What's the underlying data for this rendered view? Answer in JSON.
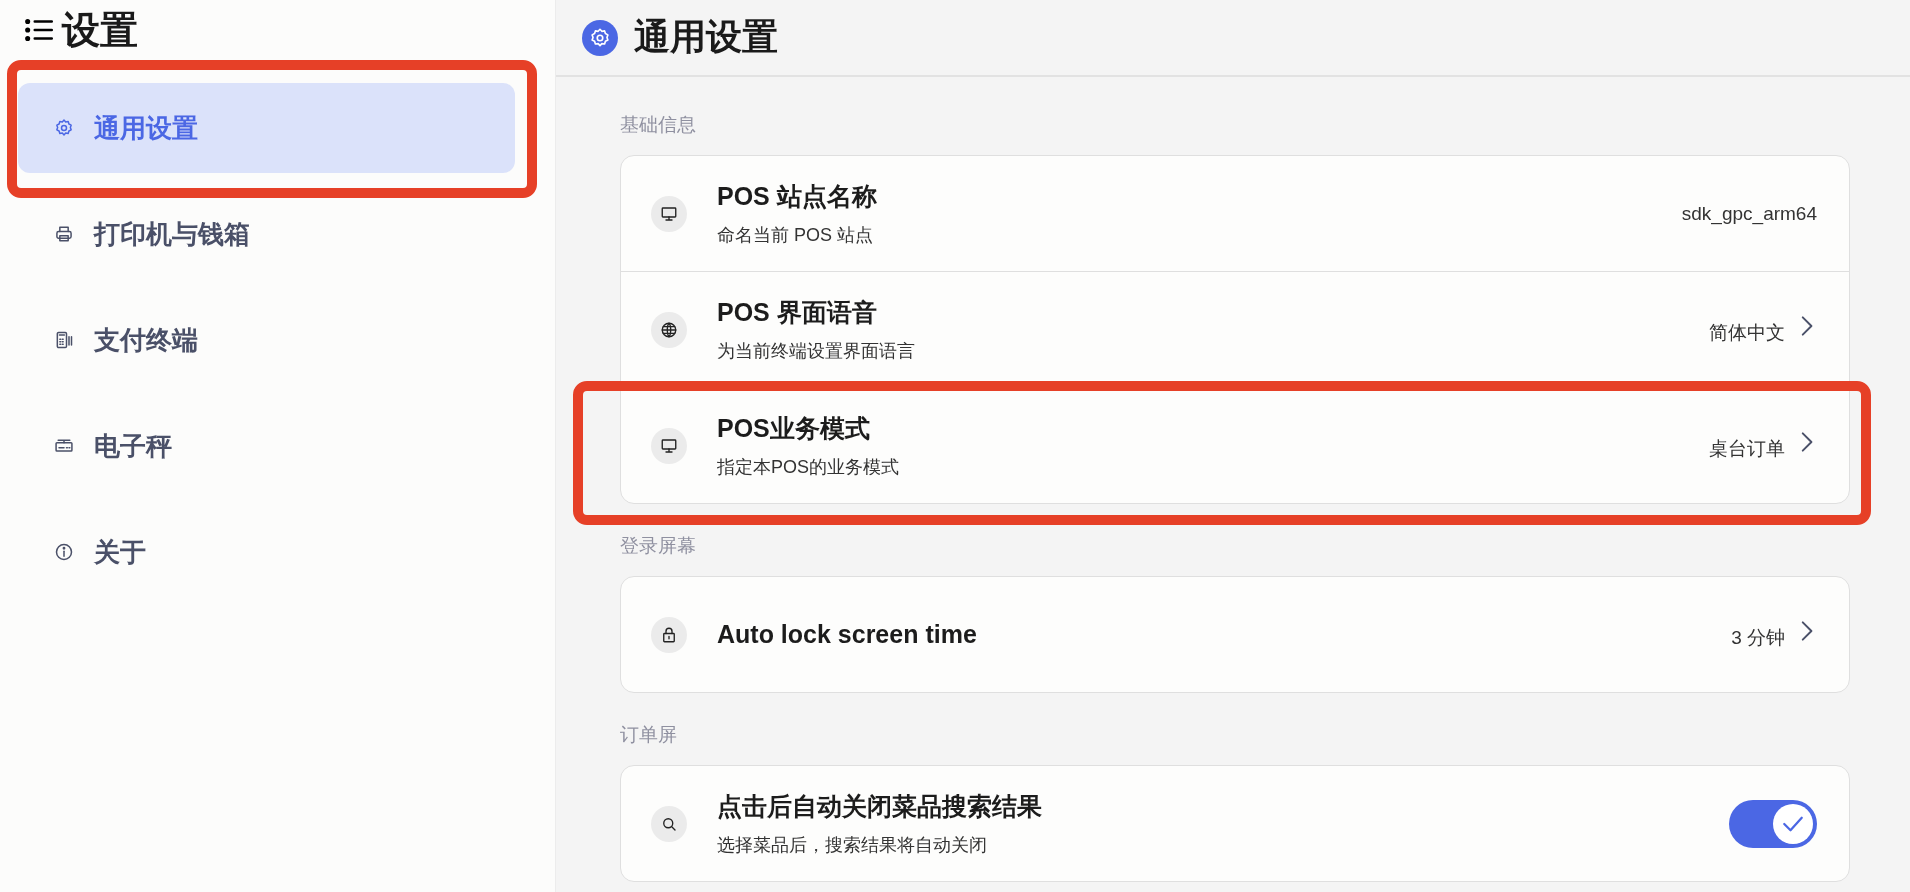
{
  "sidebar": {
    "title": "设置",
    "items": [
      {
        "label": "通用设置",
        "selected": true,
        "annotated": true
      },
      {
        "label": "打印机与钱箱",
        "selected": false,
        "annotated": false
      },
      {
        "label": "支付终端",
        "selected": false,
        "annotated": false
      },
      {
        "label": "电子秤",
        "selected": false,
        "annotated": false
      },
      {
        "label": "关于",
        "selected": false,
        "annotated": false
      }
    ]
  },
  "header": {
    "title": "通用设置"
  },
  "sections": [
    {
      "label": "基础信息",
      "rows": [
        {
          "kind": "value",
          "title": "POS 站点名称",
          "subtitle": "命名当前 POS 站点",
          "value": "sdk_gpc_arm64",
          "annotated": false
        },
        {
          "kind": "select",
          "title": "POS 界面语音",
          "subtitle": "为当前终端设置界面语言",
          "value": "简体中文",
          "annotated": false
        },
        {
          "kind": "select",
          "title": "POS业务模式",
          "subtitle": "指定本POS的业务模式",
          "value": "桌台订单",
          "annotated": true
        }
      ]
    },
    {
      "label": "登录屏幕",
      "rows": [
        {
          "kind": "select",
          "title": "Auto lock screen time",
          "value": "3 分钟",
          "annotated": false
        }
      ]
    },
    {
      "label": "订单屏",
      "rows": [
        {
          "kind": "toggle",
          "title": "点击后自动关闭菜品搜索结果",
          "subtitle": "选择菜品后，搜索结果将自动关闭",
          "on": true,
          "annotated": false
        }
      ]
    }
  ]
}
